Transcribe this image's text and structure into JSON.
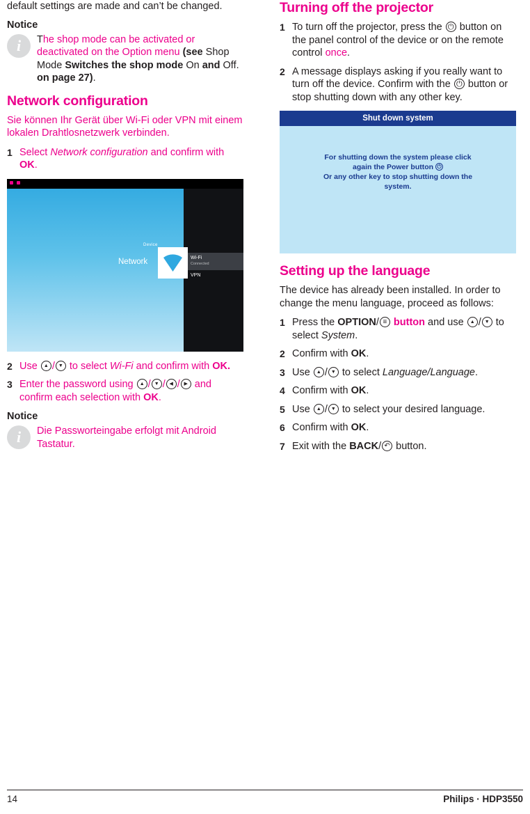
{
  "left": {
    "intro_para": "default settings are made and can’t be changed.",
    "notice1": {
      "heading": "Notice",
      "icon": "info-icon",
      "text_parts": [
        {
          "t": "T",
          "style": "plain"
        },
        {
          "t": "he shop mode can be activated or deactivated on the Option menu ",
          "style": "magenta"
        },
        {
          "t": "(see ",
          "style": "bold"
        },
        {
          "t": "Shop Mode ",
          "style": "plain"
        },
        {
          "t": "Switches the shop mode ",
          "style": "bold"
        },
        {
          "t": "On ",
          "style": "plain"
        },
        {
          "t": "and ",
          "style": "bold"
        },
        {
          "t": "Off. ",
          "style": "plain"
        },
        {
          "t": "on page 27)",
          "style": "bold"
        },
        {
          "t": ".",
          "style": "plain"
        }
      ]
    },
    "network_heading": "Network configuration",
    "network_para": "Sie können Ihr Gerät über Wi-Fi oder VPN mit einem lokalen Drahtlosnetzwerk verbinden.",
    "steps": [
      {
        "num": "1",
        "parts": [
          {
            "t": "Select ",
            "style": "magenta"
          },
          {
            "t": "Network configuration",
            "style": "magenta-italic"
          },
          {
            "t": " and confirm with ",
            "style": "magenta"
          },
          {
            "t": "OK",
            "style": "magenta-bold"
          },
          {
            "t": ".",
            "style": "magenta"
          }
        ]
      }
    ],
    "steps_after_shot": [
      {
        "num": "2",
        "parts": [
          {
            "t": "Use ",
            "style": "magenta"
          },
          {
            "t": "KEY_UP",
            "style": "key"
          },
          {
            "t": "/",
            "style": "magenta"
          },
          {
            "t": "KEY_DOWN",
            "style": "key"
          },
          {
            "t": " to select ",
            "style": "magenta"
          },
          {
            "t": "Wi-Fi",
            "style": "magenta-italic"
          },
          {
            "t": " and confirm with ",
            "style": "magenta"
          },
          {
            "t": "OK.",
            "style": "magenta-bold"
          }
        ]
      },
      {
        "num": "3",
        "parts": [
          {
            "t": "Enter the password using ",
            "style": "magenta"
          },
          {
            "t": "KEY_UP",
            "style": "key"
          },
          {
            "t": "/",
            "style": "magenta"
          },
          {
            "t": "KEY_DOWN",
            "style": "key"
          },
          {
            "t": "/",
            "style": "magenta"
          },
          {
            "t": "KEY_LEFT",
            "style": "key"
          },
          {
            "t": "/",
            "style": "magenta"
          },
          {
            "t": "KEY_RIGHT",
            "style": "key"
          },
          {
            "t": " and confirm each selection with ",
            "style": "magenta"
          },
          {
            "t": "OK",
            "style": "magenta-bold"
          },
          {
            "t": ".",
            "style": "magenta"
          }
        ]
      }
    ],
    "notice2": {
      "heading": "Notice",
      "icon": "info-icon",
      "text": "Die Passworteingabe erfolgt mit Android Tastatur."
    },
    "screenshot": {
      "name": "network-configuration-screen",
      "device_label": "Device",
      "network_label": "Network",
      "items": [
        {
          "label": "Wi-Fi",
          "sub": "Connected"
        },
        {
          "label": "VPN",
          "sub": ""
        }
      ]
    }
  },
  "right": {
    "turnoff_heading": "Turning off the projector",
    "turnoff_steps": [
      {
        "num": "1",
        "parts": [
          {
            "t": "To turn off the projector, press the ",
            "style": "plain"
          },
          {
            "t": "KEY_POWER",
            "style": "key"
          },
          {
            "t": " button on the panel control of the device or on the remote control ",
            "style": "plain"
          },
          {
            "t": "once",
            "style": "magenta"
          },
          {
            "t": ".",
            "style": "plain"
          }
        ]
      },
      {
        "num": "2",
        "parts": [
          {
            "t": "A message displays asking if you really want to turn off the device. Confirm with the ",
            "style": "plain"
          },
          {
            "t": "KEY_POWER",
            "style": "key"
          },
          {
            "t": " button or stop shutting down with any other key.",
            "style": "plain"
          }
        ]
      }
    ],
    "dialog": {
      "title": "Shut down system",
      "line1": "For shutting down the system please click",
      "line2a": "again the Power button ",
      "line2_icon": "power-icon",
      "line3": "Or any other key to stop shutting down the",
      "line4": "system."
    },
    "language_heading": "Setting up the language",
    "language_para": "The device has already been installed. In order to change the menu language, proceed as follows:",
    "language_steps": [
      {
        "num": "1",
        "parts": [
          {
            "t": "Press the ",
            "style": "plain"
          },
          {
            "t": "OPTION",
            "style": "bold"
          },
          {
            "t": "/",
            "style": "plain"
          },
          {
            "t": "KEY_OPT",
            "style": "key"
          },
          {
            "t": " button",
            "style": "magenta-bold"
          },
          {
            "t": " and use ",
            "style": "plain"
          },
          {
            "t": "KEY_UP",
            "style": "key"
          },
          {
            "t": "/",
            "style": "plain"
          },
          {
            "t": "KEY_DOWN",
            "style": "key"
          },
          {
            "t": " to select ",
            "style": "plain"
          },
          {
            "t": "System",
            "style": "italic"
          },
          {
            "t": ".",
            "style": "plain"
          }
        ]
      },
      {
        "num": "2",
        "parts": [
          {
            "t": "Confirm with ",
            "style": "plain"
          },
          {
            "t": "OK",
            "style": "bold"
          },
          {
            "t": ".",
            "style": "plain"
          }
        ]
      },
      {
        "num": "3",
        "parts": [
          {
            "t": "Use ",
            "style": "plain"
          },
          {
            "t": "KEY_UP",
            "style": "key"
          },
          {
            "t": "/",
            "style": "plain"
          },
          {
            "t": "KEY_DOWN",
            "style": "key"
          },
          {
            "t": " to select ",
            "style": "plain"
          },
          {
            "t": "Language/Language",
            "style": "italic"
          },
          {
            "t": ".",
            "style": "plain"
          }
        ]
      },
      {
        "num": "4",
        "parts": [
          {
            "t": "Confirm with ",
            "style": "plain"
          },
          {
            "t": "OK",
            "style": "bold"
          },
          {
            "t": ".",
            "style": "plain"
          }
        ]
      },
      {
        "num": "5",
        "parts": [
          {
            "t": "Use ",
            "style": "plain"
          },
          {
            "t": "KEY_UP",
            "style": "key"
          },
          {
            "t": "/",
            "style": "plain"
          },
          {
            "t": "KEY_DOWN",
            "style": "key"
          },
          {
            "t": " to select your desired language.",
            "style": "plain"
          }
        ]
      },
      {
        "num": "6",
        "parts": [
          {
            "t": "Confirm with ",
            "style": "plain"
          },
          {
            "t": "OK",
            "style": "bold"
          },
          {
            "t": ".",
            "style": "plain"
          }
        ]
      },
      {
        "num": "7",
        "parts": [
          {
            "t": "Exit with the ",
            "style": "plain"
          },
          {
            "t": "BACK",
            "style": "bold"
          },
          {
            "t": "/",
            "style": "plain"
          },
          {
            "t": "KEY_BACK",
            "style": "key"
          },
          {
            "t": " button.",
            "style": "plain"
          }
        ]
      }
    ]
  },
  "footer": {
    "page_number": "14",
    "product": "Philips · HDP3550"
  },
  "colors": {
    "accent_magenta": "#ec008c",
    "dialog_blue": "#1b3b8f",
    "dialog_bg": "#bfe5f6",
    "text": "#231f20"
  }
}
